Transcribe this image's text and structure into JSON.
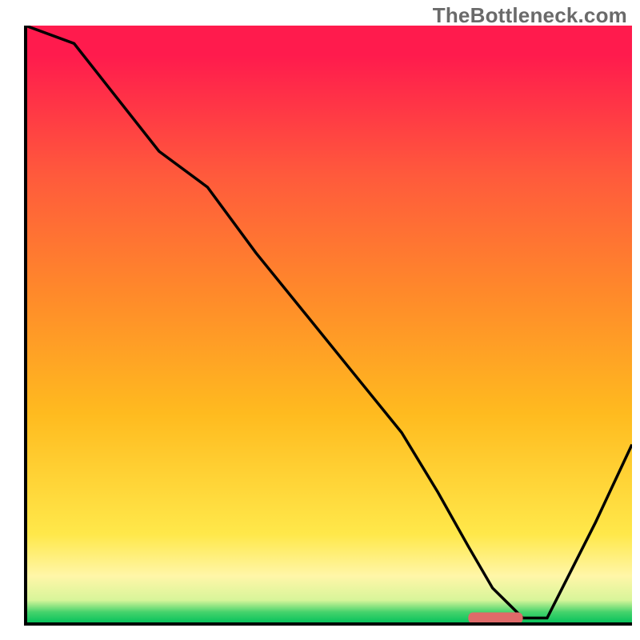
{
  "watermark": "TheBottleneck.com",
  "chart_data": {
    "type": "line",
    "title": "",
    "xlabel": "",
    "ylabel": "",
    "xlim": [
      0,
      100
    ],
    "ylim": [
      0,
      100
    ],
    "x": [
      0,
      8,
      22,
      30,
      38,
      46,
      54,
      62,
      68,
      73,
      77,
      82,
      86,
      90,
      94,
      100
    ],
    "values": [
      100,
      97,
      79,
      73,
      62,
      52,
      42,
      32,
      22,
      13,
      6,
      1,
      1,
      9,
      17,
      30
    ],
    "marker": {
      "x_start": 73,
      "x_end": 82,
      "y": 1
    },
    "gradient_bands": [
      {
        "from": "#ff1b4d",
        "to": "#ff1b4d",
        "y0": 100,
        "y1": 95
      },
      {
        "from": "#ff1b4d",
        "to": "#ff5a3c",
        "y0": 95,
        "y1": 75
      },
      {
        "from": "#ff5a3c",
        "to": "#ff8a2a",
        "y0": 75,
        "y1": 55
      },
      {
        "from": "#ff8a2a",
        "to": "#ffbb1f",
        "y0": 55,
        "y1": 35
      },
      {
        "from": "#ffbb1f",
        "to": "#ffe84a",
        "y0": 35,
        "y1": 15
      },
      {
        "from": "#ffe84a",
        "to": "#fff6a8",
        "y0": 15,
        "y1": 8
      },
      {
        "from": "#fff6a8",
        "to": "#d8f59a",
        "y0": 8,
        "y1": 4
      },
      {
        "from": "#d8f59a",
        "to": "#46d36c",
        "y0": 4,
        "y1": 2
      },
      {
        "from": "#46d36c",
        "to": "#00c05a",
        "y0": 2,
        "y1": 0
      }
    ],
    "axis_color": "#000000",
    "line_color": "#000000",
    "marker_color": "#df6a69"
  }
}
